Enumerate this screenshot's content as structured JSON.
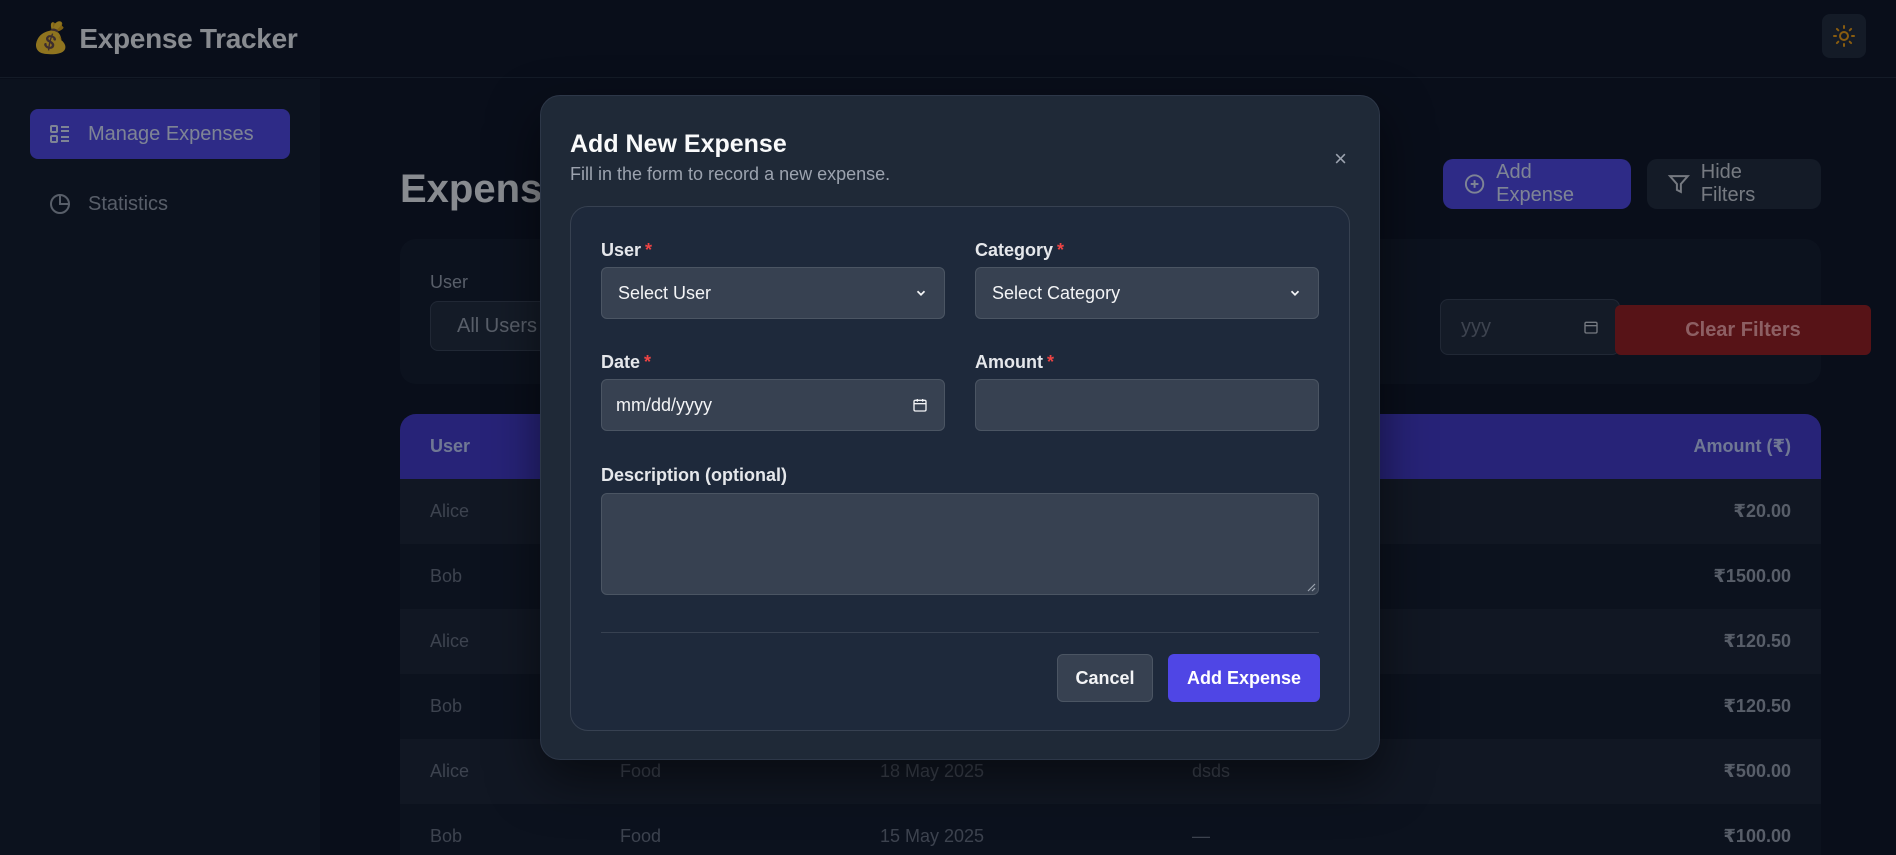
{
  "header": {
    "logo_icon": "money-bag-icon",
    "title": "Expense Tracker",
    "theme_icon": "sun-icon"
  },
  "sidebar": {
    "items": [
      {
        "label": "Manage Expenses",
        "icon": "list-icon",
        "active": true
      },
      {
        "label": "Statistics",
        "icon": "pie-chart-icon",
        "active": false
      }
    ]
  },
  "main": {
    "title": "Expenses",
    "add_button": "Add Expense",
    "hide_filters_button": "Hide Filters",
    "filters": {
      "user_label": "User",
      "user_value": "All Users",
      "date_placeholder": "yyy",
      "clear_button": "Clear Filters"
    },
    "table": {
      "headers": {
        "user": "User",
        "amount": "Amount (₹)"
      },
      "rows": [
        {
          "user": "Alice",
          "category": "",
          "date": "",
          "description": "",
          "amount": "₹20.00"
        },
        {
          "user": "Bob",
          "category": "",
          "date": "",
          "description": "",
          "amount": "₹1500.00"
        },
        {
          "user": "Alice",
          "category": "",
          "date": "",
          "description": "",
          "amount": "₹120.50"
        },
        {
          "user": "Bob",
          "category": "",
          "date": "",
          "description": "",
          "amount": "₹120.50"
        },
        {
          "user": "Alice",
          "category": "Food",
          "date": "18 May 2025",
          "description": "dsds",
          "amount": "₹500.00"
        },
        {
          "user": "Bob",
          "category": "Food",
          "date": "15 May 2025",
          "description": "—",
          "amount": "₹100.00"
        }
      ]
    }
  },
  "modal": {
    "title": "Add New Expense",
    "subtitle": "Fill in the form to record a new expense.",
    "close": "×",
    "fields": {
      "user_label": "User",
      "user_value": "Select User",
      "category_label": "Category",
      "category_value": "Select Category",
      "date_label": "Date",
      "date_value": "mm/dd/yyyy",
      "amount_label": "Amount",
      "amount_value": "",
      "description_label": "Description (optional)",
      "description_value": "",
      "required_mark": "*"
    },
    "cancel_button": "Cancel",
    "submit_button": "Add Expense"
  },
  "colors": {
    "accent": "#4f46e5",
    "danger": "#991b1b",
    "background": "#0b1120"
  }
}
